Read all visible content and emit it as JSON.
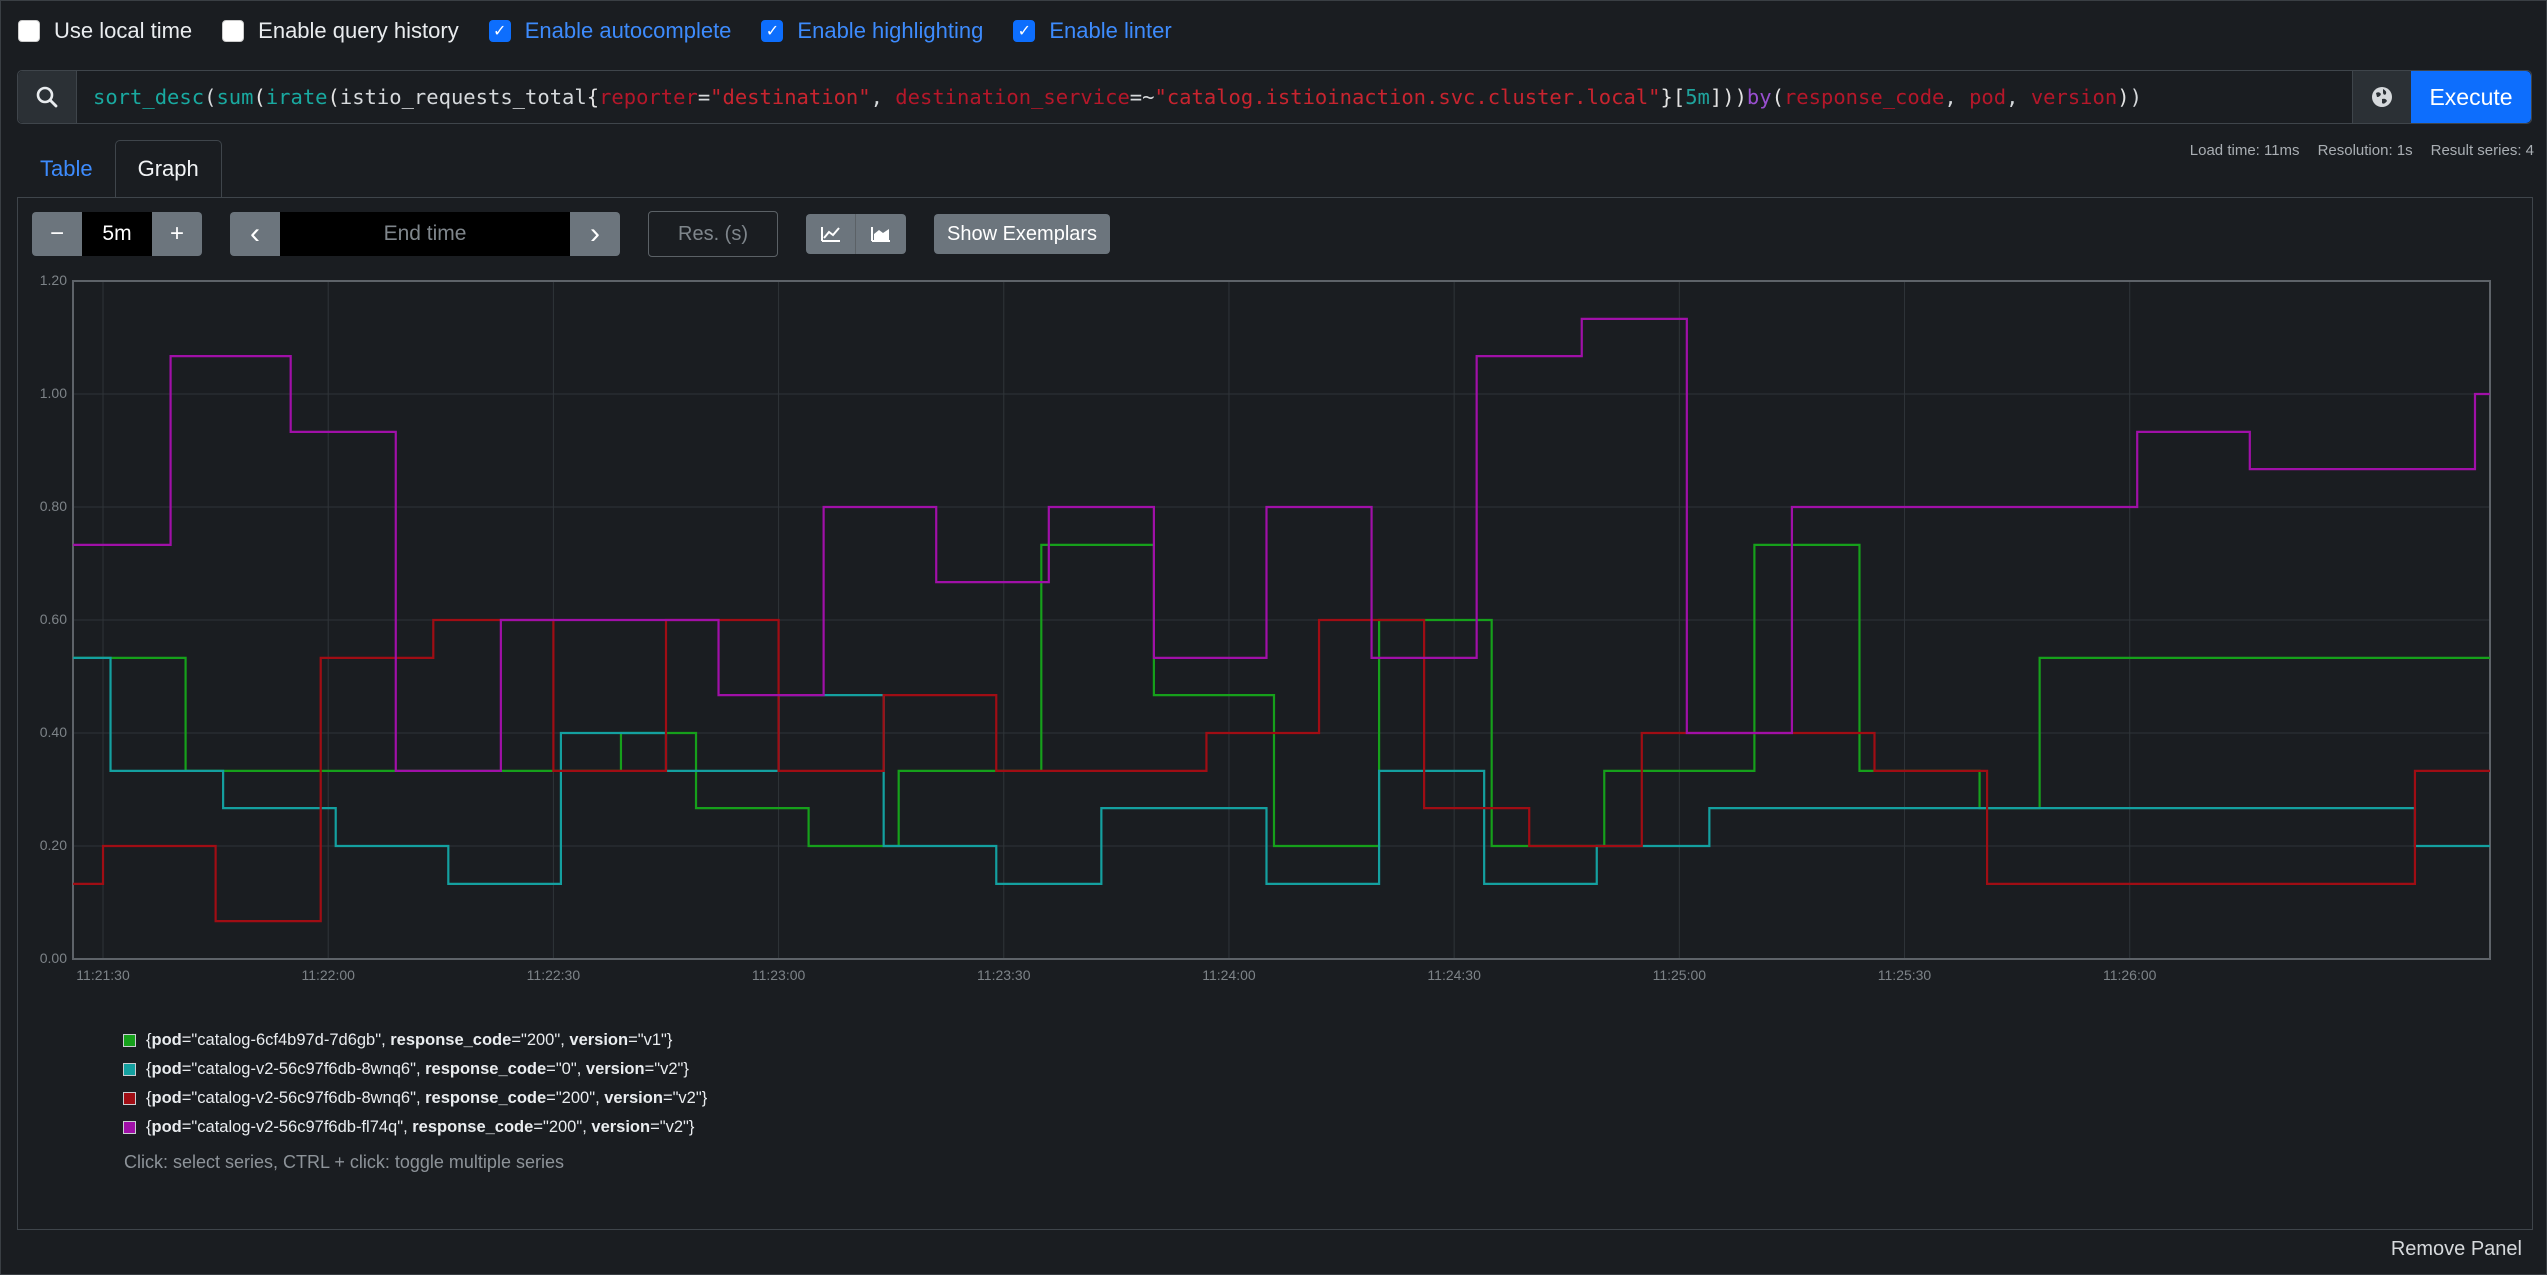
{
  "options": [
    {
      "label": "Use local time",
      "checked": false
    },
    {
      "label": "Enable query history",
      "checked": false
    },
    {
      "label": "Enable autocomplete",
      "checked": true
    },
    {
      "label": "Enable highlighting",
      "checked": true
    },
    {
      "label": "Enable linter",
      "checked": true
    }
  ],
  "query": {
    "tokens": [
      {
        "t": "sort_desc",
        "c": "fn"
      },
      {
        "t": "(",
        "c": "cursor"
      },
      {
        "t": "sum",
        "c": "fn"
      },
      {
        "t": "(",
        "c": "paren"
      },
      {
        "t": "irate",
        "c": "fn"
      },
      {
        "t": "(",
        "c": "paren"
      },
      {
        "t": "istio_requests_total",
        "c": "metric"
      },
      {
        "t": "{",
        "c": "paren"
      },
      {
        "t": "reporter",
        "c": "label"
      },
      {
        "t": "=",
        "c": "op"
      },
      {
        "t": "\"destination\"",
        "c": "str"
      },
      {
        "t": ", ",
        "c": "op"
      },
      {
        "t": "destination_service",
        "c": "label"
      },
      {
        "t": "=~",
        "c": "op"
      },
      {
        "t": "\"catalog.istioinaction.svc.cluster.local\"",
        "c": "str"
      },
      {
        "t": "}",
        "c": "paren"
      },
      {
        "t": "[",
        "c": "paren"
      },
      {
        "t": "5m",
        "c": "dur"
      },
      {
        "t": "]))",
        "c": "paren"
      },
      {
        "t": "by",
        "c": "kw"
      },
      {
        "t": "(",
        "c": "paren"
      },
      {
        "t": "response_code",
        "c": "label"
      },
      {
        "t": ", ",
        "c": "op"
      },
      {
        "t": "pod",
        "c": "label"
      },
      {
        "t": ", ",
        "c": "op"
      },
      {
        "t": "version",
        "c": "label"
      },
      {
        "t": ")",
        "c": "paren"
      },
      {
        "t": ")",
        "c": "cursor"
      }
    ],
    "search_icon": "search-icon",
    "globe_icon": "globe-icon",
    "execute_label": "Execute"
  },
  "tabs": {
    "table": "Table",
    "graph": "Graph"
  },
  "stats": {
    "load": "Load time: 11ms",
    "resolution": "Resolution: 1s",
    "series": "Result series: 4"
  },
  "controls": {
    "minus": "−",
    "range": "5m",
    "plus": "+",
    "prev": "‹",
    "end_time_placeholder": "End time",
    "next": "›",
    "res_placeholder": "Res. (s)",
    "line_icon": "line-chart-icon",
    "stacked_icon": "stacked-chart-icon",
    "exemplars": "Show Exemplars"
  },
  "chart_data": {
    "type": "line",
    "step": true,
    "x_ticks": [
      "11:21:30",
      "11:22:00",
      "11:22:30",
      "11:23:00",
      "11:23:30",
      "11:24:00",
      "11:24:30",
      "11:25:00",
      "11:25:30",
      "11:26:00"
    ],
    "y_ticks": [
      "0.00",
      "0.20",
      "0.40",
      "0.60",
      "0.80",
      "1.00",
      "1.20"
    ],
    "ylim": [
      0,
      1.2
    ],
    "xlim": [
      "11:21:26",
      "11:26:48"
    ],
    "grid": true,
    "series": [
      {
        "name": "{pod=\"catalog-6cf4b97d-7d6gb\", response_code=\"200\", version=\"v1\"}",
        "color": "#16a01b",
        "points": [
          [
            "11:21:26",
            0.533
          ],
          [
            "11:21:41",
            0.333
          ],
          [
            "11:22:39",
            0.4
          ],
          [
            "11:22:49",
            0.267
          ],
          [
            "11:23:04",
            0.2
          ],
          [
            "11:23:16",
            0.333
          ],
          [
            "11:23:35",
            0.733
          ],
          [
            "11:23:50",
            0.467
          ],
          [
            "11:24:06",
            0.2
          ],
          [
            "11:24:20",
            0.6
          ],
          [
            "11:24:35",
            0.2
          ],
          [
            "11:24:50",
            0.333
          ],
          [
            "11:25:10",
            0.733
          ],
          [
            "11:25:24",
            0.333
          ],
          [
            "11:25:40",
            0.267
          ],
          [
            "11:25:48",
            0.533
          ],
          [
            "11:26:48",
            0.533
          ]
        ]
      },
      {
        "name": "{pod=\"catalog-v2-56c97f6db-8wnq6\", response_code=\"0\", version=\"v2\"}",
        "color": "#14a0a0",
        "points": [
          [
            "11:21:26",
            0.533
          ],
          [
            "11:21:31",
            0.333
          ],
          [
            "11:21:46",
            0.267
          ],
          [
            "11:22:01",
            0.2
          ],
          [
            "11:22:16",
            0.133
          ],
          [
            "11:22:31",
            0.4
          ],
          [
            "11:22:45",
            0.333
          ],
          [
            "11:23:00",
            0.467
          ],
          [
            "11:23:14",
            0.2
          ],
          [
            "11:23:29",
            0.133
          ],
          [
            "11:23:43",
            0.267
          ],
          [
            "11:24:05",
            0.133
          ],
          [
            "11:24:20",
            0.333
          ],
          [
            "11:24:34",
            0.133
          ],
          [
            "11:24:49",
            0.2
          ],
          [
            "11:25:04",
            0.267
          ],
          [
            "11:26:00",
            0.267
          ],
          [
            "11:26:12",
            0.267
          ],
          [
            "11:26:38",
            0.2
          ],
          [
            "11:26:48",
            0.2
          ]
        ]
      },
      {
        "name": "{pod=\"catalog-v2-56c97f6db-8wnq6\", response_code=\"200\", version=\"v2\"}",
        "color": "#a00d14",
        "points": [
          [
            "11:21:26",
            0.133
          ],
          [
            "11:21:30",
            0.2
          ],
          [
            "11:21:45",
            0.067
          ],
          [
            "11:21:59",
            0.533
          ],
          [
            "11:22:14",
            0.6
          ],
          [
            "11:22:30",
            0.333
          ],
          [
            "11:22:45",
            0.6
          ],
          [
            "11:23:00",
            0.333
          ],
          [
            "11:23:14",
            0.467
          ],
          [
            "11:23:29",
            0.333
          ],
          [
            "11:23:57",
            0.4
          ],
          [
            "11:24:12",
            0.6
          ],
          [
            "11:24:26",
            0.267
          ],
          [
            "11:24:40",
            0.2
          ],
          [
            "11:24:55",
            0.4
          ],
          [
            "11:25:26",
            0.333
          ],
          [
            "11:25:41",
            0.133
          ],
          [
            "11:26:11",
            0.133
          ],
          [
            "11:26:22",
            0.133
          ],
          [
            "11:26:38",
            0.333
          ],
          [
            "11:26:48",
            0.333
          ]
        ]
      },
      {
        "name": "{pod=\"catalog-v2-56c97f6db-fl74q\", response_code=\"200\", version=\"v2\"}",
        "color": "#a010a8",
        "points": [
          [
            "11:21:26",
            0.733
          ],
          [
            "11:21:39",
            1.067
          ],
          [
            "11:21:55",
            0.933
          ],
          [
            "11:22:09",
            0.333
          ],
          [
            "11:22:23",
            0.6
          ],
          [
            "11:22:52",
            0.467
          ],
          [
            "11:23:06",
            0.8
          ],
          [
            "11:23:21",
            0.667
          ],
          [
            "11:23:36",
            0.8
          ],
          [
            "11:23:50",
            0.533
          ],
          [
            "11:24:05",
            0.8
          ],
          [
            "11:24:19",
            0.533
          ],
          [
            "11:24:33",
            1.067
          ],
          [
            "11:24:47",
            1.133
          ],
          [
            "11:25:01",
            0.4
          ],
          [
            "11:25:15",
            0.8
          ],
          [
            "11:25:48",
            0.8
          ],
          [
            "11:26:01",
            0.933
          ],
          [
            "11:26:16",
            0.867
          ],
          [
            "11:26:30",
            0.867
          ],
          [
            "11:26:46",
            1.0
          ],
          [
            "11:26:48",
            1.0
          ]
        ]
      }
    ]
  },
  "legend": [
    {
      "color": "#16a01b",
      "pod": "\"catalog-6cf4b97d-7d6gb\"",
      "code": "\"200\"",
      "version": "\"v1\""
    },
    {
      "color": "#14a0a0",
      "pod": "\"catalog-v2-56c97f6db-8wnq6\"",
      "code": "\"0\"",
      "version": "\"v2\""
    },
    {
      "color": "#a00d14",
      "pod": "\"catalog-v2-56c97f6db-8wnq6\"",
      "code": "\"200\"",
      "version": "\"v2\""
    },
    {
      "color": "#a010a8",
      "pod": "\"catalog-v2-56c97f6db-fl74q\"",
      "code": "\"200\"",
      "version": "\"v2\""
    }
  ],
  "hint": "Click: select series, CTRL + click: toggle multiple series",
  "remove_panel": "Remove Panel"
}
